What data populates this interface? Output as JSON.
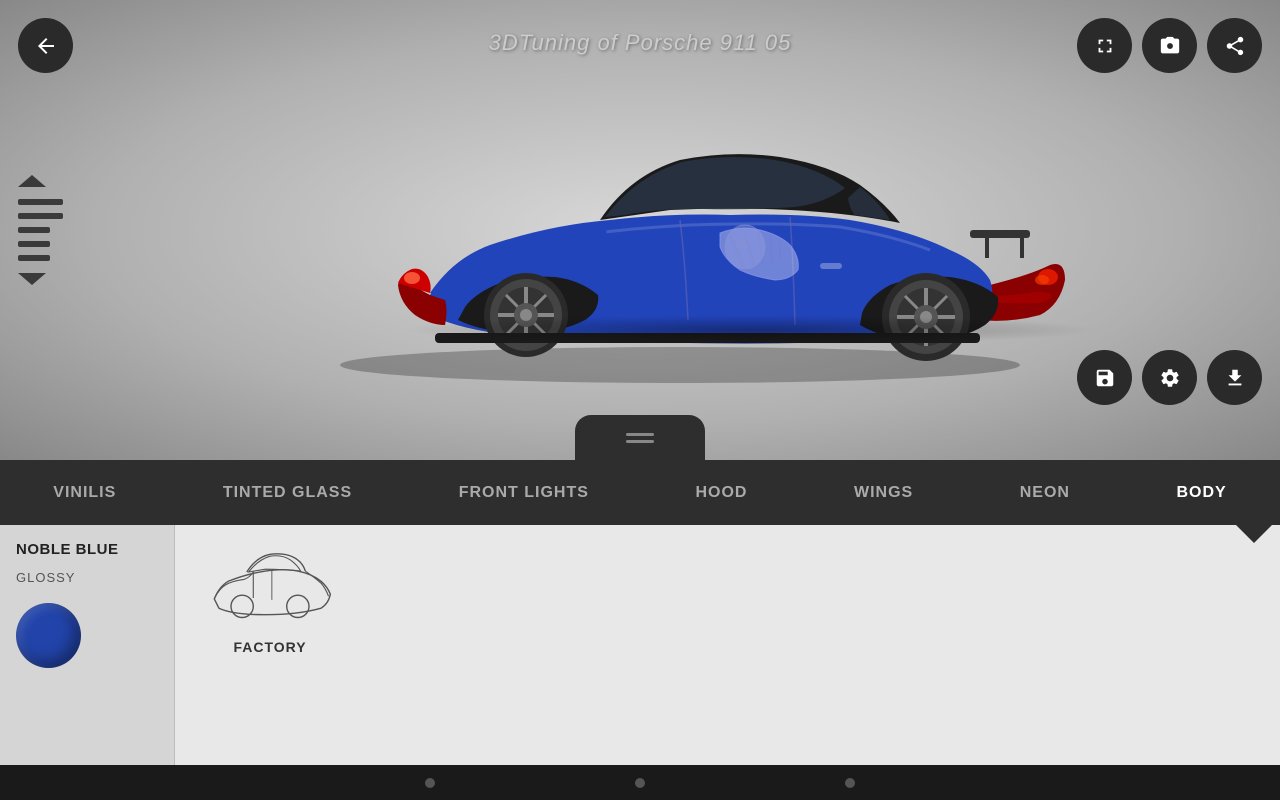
{
  "header": {
    "title": "3DTuning of Porsche 911 05",
    "back_label": "←"
  },
  "top_buttons": [
    {
      "id": "fullscreen",
      "icon": "⛶",
      "label": "fullscreen-button"
    },
    {
      "id": "camera",
      "icon": "📷",
      "label": "camera-button"
    },
    {
      "id": "share",
      "icon": "↗",
      "label": "share-button"
    }
  ],
  "bottom_buttons": [
    {
      "id": "save",
      "icon": "💾",
      "label": "save-button"
    },
    {
      "id": "settings",
      "icon": "⚙",
      "label": "settings-button"
    },
    {
      "id": "download",
      "icon": "⬇",
      "label": "download-button"
    }
  ],
  "nav_tabs": [
    {
      "id": "vinilis",
      "label": "VINILIS",
      "active": false
    },
    {
      "id": "tinted-glass",
      "label": "TINTED GLASS",
      "active": false
    },
    {
      "id": "front-lights",
      "label": "FRONT LIGHTS",
      "active": false
    },
    {
      "id": "hood",
      "label": "HOOD",
      "active": false
    },
    {
      "id": "wings",
      "label": "WINGS",
      "active": false
    },
    {
      "id": "neon",
      "label": "NEON",
      "active": false
    },
    {
      "id": "body",
      "label": "BODY",
      "active": true
    }
  ],
  "left_panel": {
    "color_name": "NOBLE BLUE",
    "color_finish": "GLOSSY",
    "color_hex": "#2244aa"
  },
  "body_options": [
    {
      "id": "factory",
      "label": "FACTORY"
    }
  ],
  "bottom_dots": [
    {
      "active": false
    },
    {
      "active": false
    },
    {
      "active": false
    }
  ]
}
